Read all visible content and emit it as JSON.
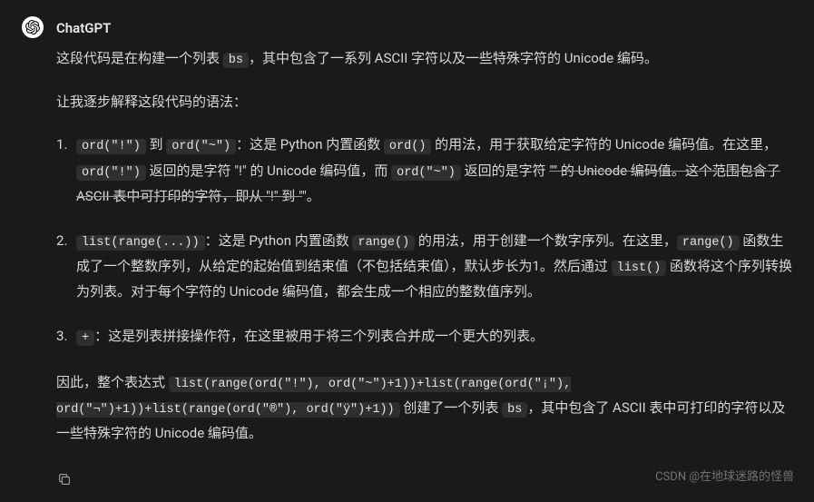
{
  "sender": "ChatGPT",
  "intro": {
    "t1": "这段代码是在构建一个列表 ",
    "c1": "bs",
    "t2": "，其中包含了一系列 ASCII 字符以及一些特殊字符的 Unicode 编码。"
  },
  "lead": "让我逐步解释这段代码的语法：",
  "items": [
    {
      "p1_c1": "ord(\"!\")",
      "p1_t1": " 到 ",
      "p1_c2": "ord(\"~\")",
      "p1_t2": "：这是 Python 内置函数 ",
      "p1_c3": "ord()",
      "p1_t3": " 的用法，用于获取给定字符的 Unicode 编码值。在这里，",
      "p1_c4": "ord(\"!\")",
      "p1_t4": " 返回的是字符 \"!\" 的 Unicode 编码值，而 ",
      "p1_c5": "ord(\"~\")",
      "p1_t5": " 返回的是字符 ",
      "p1_strike": "\"\" 的 Unicode 编码值。这个范围包含了 ASCII 表中可打印的字符，即从 \"!\" 到 \"",
      "p1_t6": "\"。"
    },
    {
      "p2_c1": "list(range(...))",
      "p2_t1": "：这是 Python 内置函数 ",
      "p2_c2": "range()",
      "p2_t2": " 的用法，用于创建一个数字序列。在这里，",
      "p2_c3": "range()",
      "p2_t3": " 函数生成了一个整数序列，从给定的起始值到结束值（不包括结束值），默认步长为1。然后通过 ",
      "p2_c4": "list()",
      "p2_t4": " 函数将这个序列转换为列表。对于每个字符的 Unicode 编码值，都会生成一个相应的整数值序列。"
    },
    {
      "p3_c1": "+",
      "p3_t1": "：这是列表拼接操作符，在这里被用于将三个列表合并成一个更大的列表。"
    }
  ],
  "conclusion": {
    "t1": "因此，整个表达式 ",
    "c1": "list(range(ord(\"!\"), ord(\"~\")+1))+list(range(ord(\"¡\"), ord(\"¬\")+1))+list(range(ord(\"®\"), ord(\"ÿ\")+1))",
    "t2": " 创建了一个列表 ",
    "c2": "bs",
    "t3": "，其中包含了 ASCII 表中可打印的字符以及一些特殊字符的 Unicode 编码值。"
  },
  "watermark": "CSDN @在地球迷路的怪兽"
}
